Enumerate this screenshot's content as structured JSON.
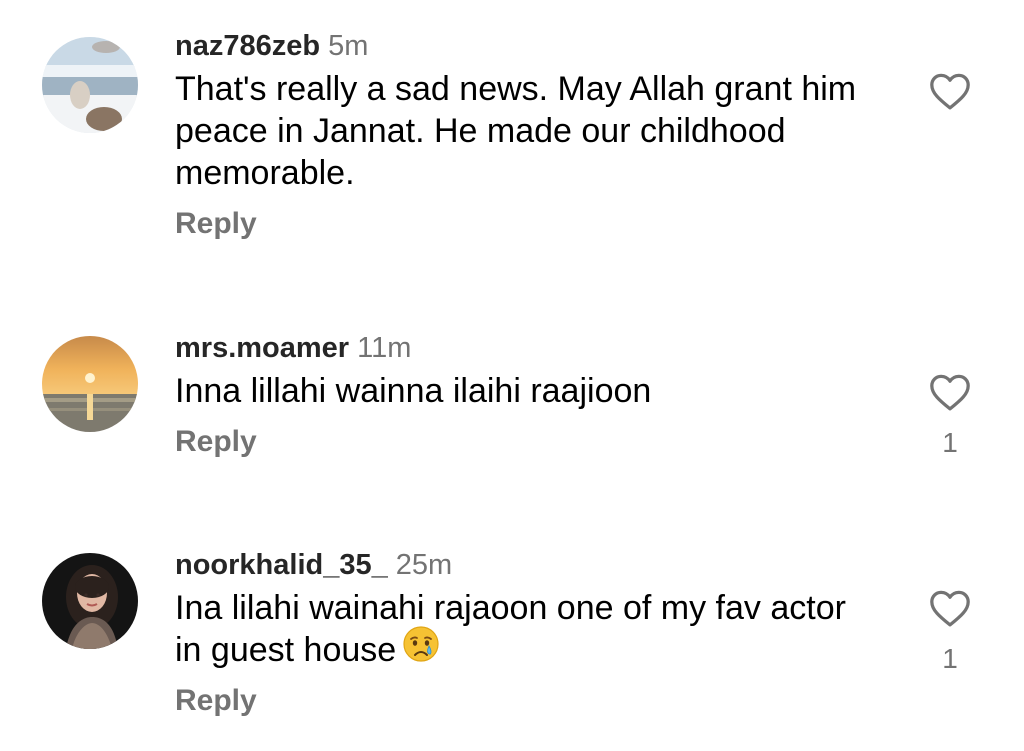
{
  "comments": [
    {
      "username": "naz786zeb",
      "time": "5m",
      "text": "That's really a sad news. May Allah grant him peace in Jannat. He made our childhood memorable.",
      "reply": "Reply",
      "like_count": ""
    },
    {
      "username": "mrs.moamer",
      "time": "11m",
      "text": "Inna lillahi wainna ilaihi raajioon",
      "reply": "Reply",
      "like_count": "1"
    },
    {
      "username": "noorkhalid_35_",
      "time": "25m",
      "text": "Ina lilahi wainahi rajaoon one of my fav actor in guest house",
      "reply": "Reply",
      "like_count": "1"
    }
  ],
  "icons": {
    "like": "heart-outline-icon",
    "emoji": "crying-face-emoji"
  },
  "colors": {
    "text": "#000000",
    "username": "#262626",
    "secondary": "#737373"
  }
}
